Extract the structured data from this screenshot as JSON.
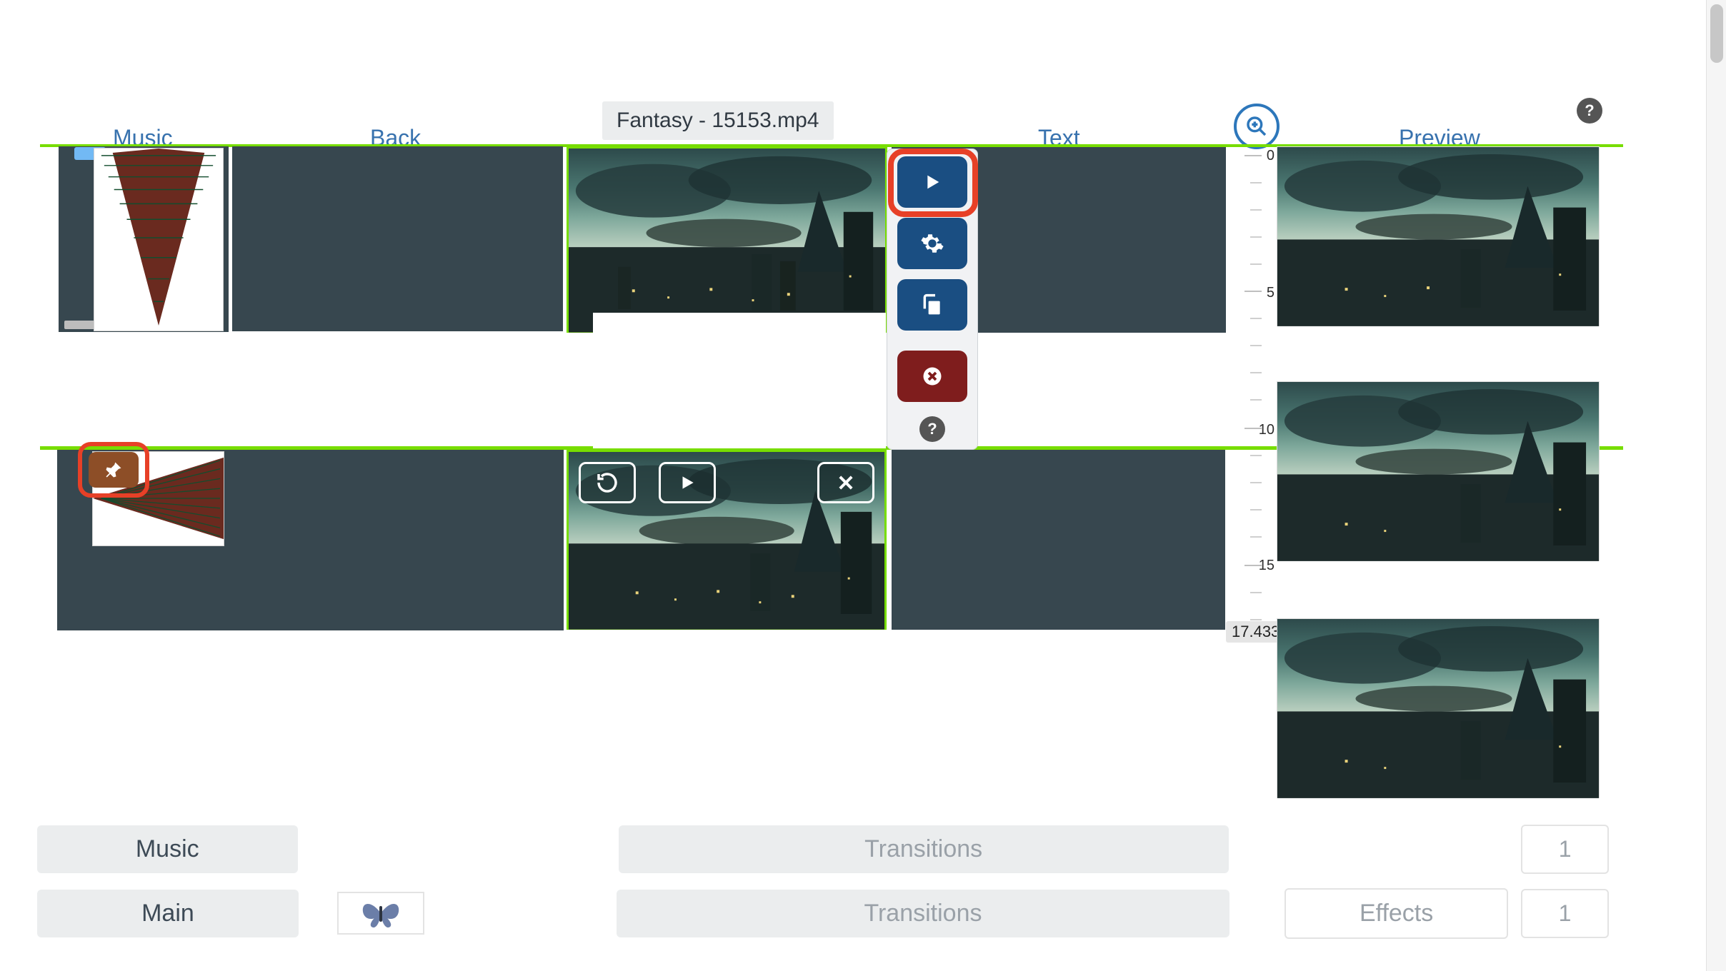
{
  "columns": {
    "music": "Music",
    "back": "Back",
    "text": "Text",
    "preview": "Preview"
  },
  "clip": {
    "filename": "Fantasy - 15153.mp4"
  },
  "ruler": {
    "ticks": [
      "0",
      "5",
      "10",
      "15"
    ],
    "end": "17.433"
  },
  "popup": {
    "play": "play-icon",
    "settings": "gear-icon",
    "duplicate": "duplicate-icon",
    "delete": "delete-icon",
    "help": "?"
  },
  "overlay": {
    "reset": "reset-icon",
    "play": "play-icon",
    "close": "close-icon"
  },
  "bottom": {
    "rows": [
      {
        "label": "Music",
        "center": "Transitions",
        "right_center": "",
        "right_val": "1"
      },
      {
        "label": "Main",
        "center": "Transitions",
        "right_center": "Effects",
        "right_val": "1"
      }
    ]
  },
  "help_top": "?",
  "colors": {
    "accent": "#2d77bb",
    "dark_btn": "#1a4e82",
    "danger": "#7f1d1d",
    "highlight": "#e74027",
    "green": "#77dd00",
    "lane": "#37474f"
  }
}
